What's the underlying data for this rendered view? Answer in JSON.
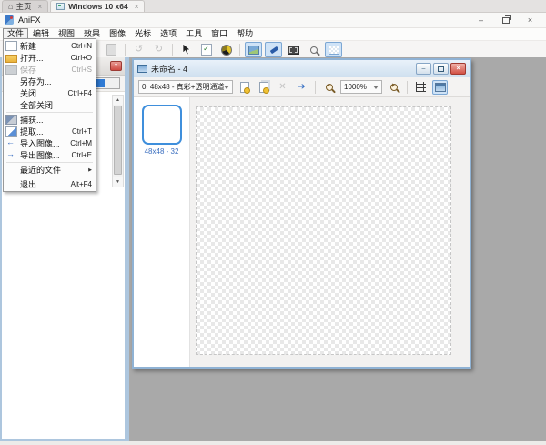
{
  "tab_bar": {
    "tabs": [
      {
        "label": "主页"
      },
      {
        "label": "Windows 10 x64"
      }
    ],
    "close_glyph": "×"
  },
  "app": {
    "title": "AniFX",
    "controls": {
      "minimize": "–",
      "close": "×"
    }
  },
  "menu_bar": {
    "items": [
      "文件",
      "编辑",
      "视图",
      "效果",
      "图像",
      "光标",
      "选项",
      "工具",
      "窗口",
      "帮助"
    ]
  },
  "file_menu": {
    "submenu_arrow": "▶",
    "items": [
      {
        "label": "新建",
        "shortcut": "Ctrl+N"
      },
      {
        "label": "打开...",
        "shortcut": "Ctrl+O"
      },
      {
        "label": "保存",
        "shortcut": "Ctrl+S"
      },
      {
        "label": "另存为...",
        "shortcut": ""
      },
      {
        "label": "关闭",
        "shortcut": "Ctrl+F4"
      },
      {
        "label": "全部关闭",
        "shortcut": ""
      },
      {
        "label": "捕获...",
        "shortcut": ""
      },
      {
        "label": "提取...",
        "shortcut": "Ctrl+T"
      },
      {
        "label": "导入图像...",
        "shortcut": "Ctrl+M"
      },
      {
        "label": "导出图像...",
        "shortcut": "Ctrl+E"
      },
      {
        "label": "最近的文件",
        "shortcut": ""
      },
      {
        "label": "退出",
        "shortcut": "Alt+F4"
      }
    ]
  },
  "doc_window": {
    "title": "未命名 - 4",
    "controls": {
      "minimize": "–",
      "close": "×"
    },
    "toolbar": {
      "format_value": "0: 48x48 - 真彩+透明通道",
      "zoom_value": "1000%"
    },
    "thumbnail_label": "48x48 - 32"
  },
  "colors": {
    "accent_blue": "#3f8fdc",
    "selection_blue": "#2f7ad4",
    "workspace_gray": "#a9a9a9",
    "close_red": "#d25045"
  }
}
